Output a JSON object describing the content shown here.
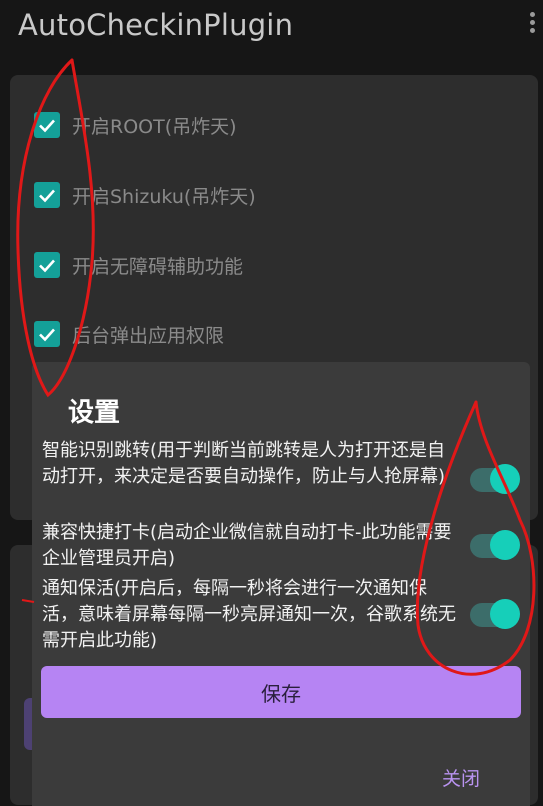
{
  "app": {
    "title": "AutoCheckinPlugin",
    "menu_icon": "more-vert-icon"
  },
  "main": {
    "checkboxes": [
      {
        "label": "开启ROOT(吊炸天)",
        "checked": true
      },
      {
        "label": "开启Shizuku(吊炸天)",
        "checked": true
      },
      {
        "label": "开启无障碍辅助功能",
        "checked": true
      },
      {
        "label": "后台弹出应用权限",
        "checked": true
      }
    ]
  },
  "dialog": {
    "title": "设置",
    "settings": [
      {
        "label": "智能识别跳转(用于判断当前跳转是人为打开还是自动打开，来决定是否要自动操作，防止与人抢屏幕)",
        "enabled": true
      },
      {
        "label": "兼容快捷打卡(启动企业微信就自动打卡-此功能需要企业管理员开启)",
        "enabled": true
      },
      {
        "label": "通知保活(开启后，每隔一秒将会进行一次通知保活，意味着屏幕每隔一秒亮屏通知一次，谷歌系统无需开启此功能)",
        "enabled": true
      }
    ],
    "save_label": "保存",
    "close_label": "关闭"
  },
  "colors": {
    "accent_teal": "#16cfb9",
    "checkbox": "#14a098",
    "save_button": "#b684f3",
    "close_text": "#b993f0",
    "annotation_red": "#e01818"
  }
}
